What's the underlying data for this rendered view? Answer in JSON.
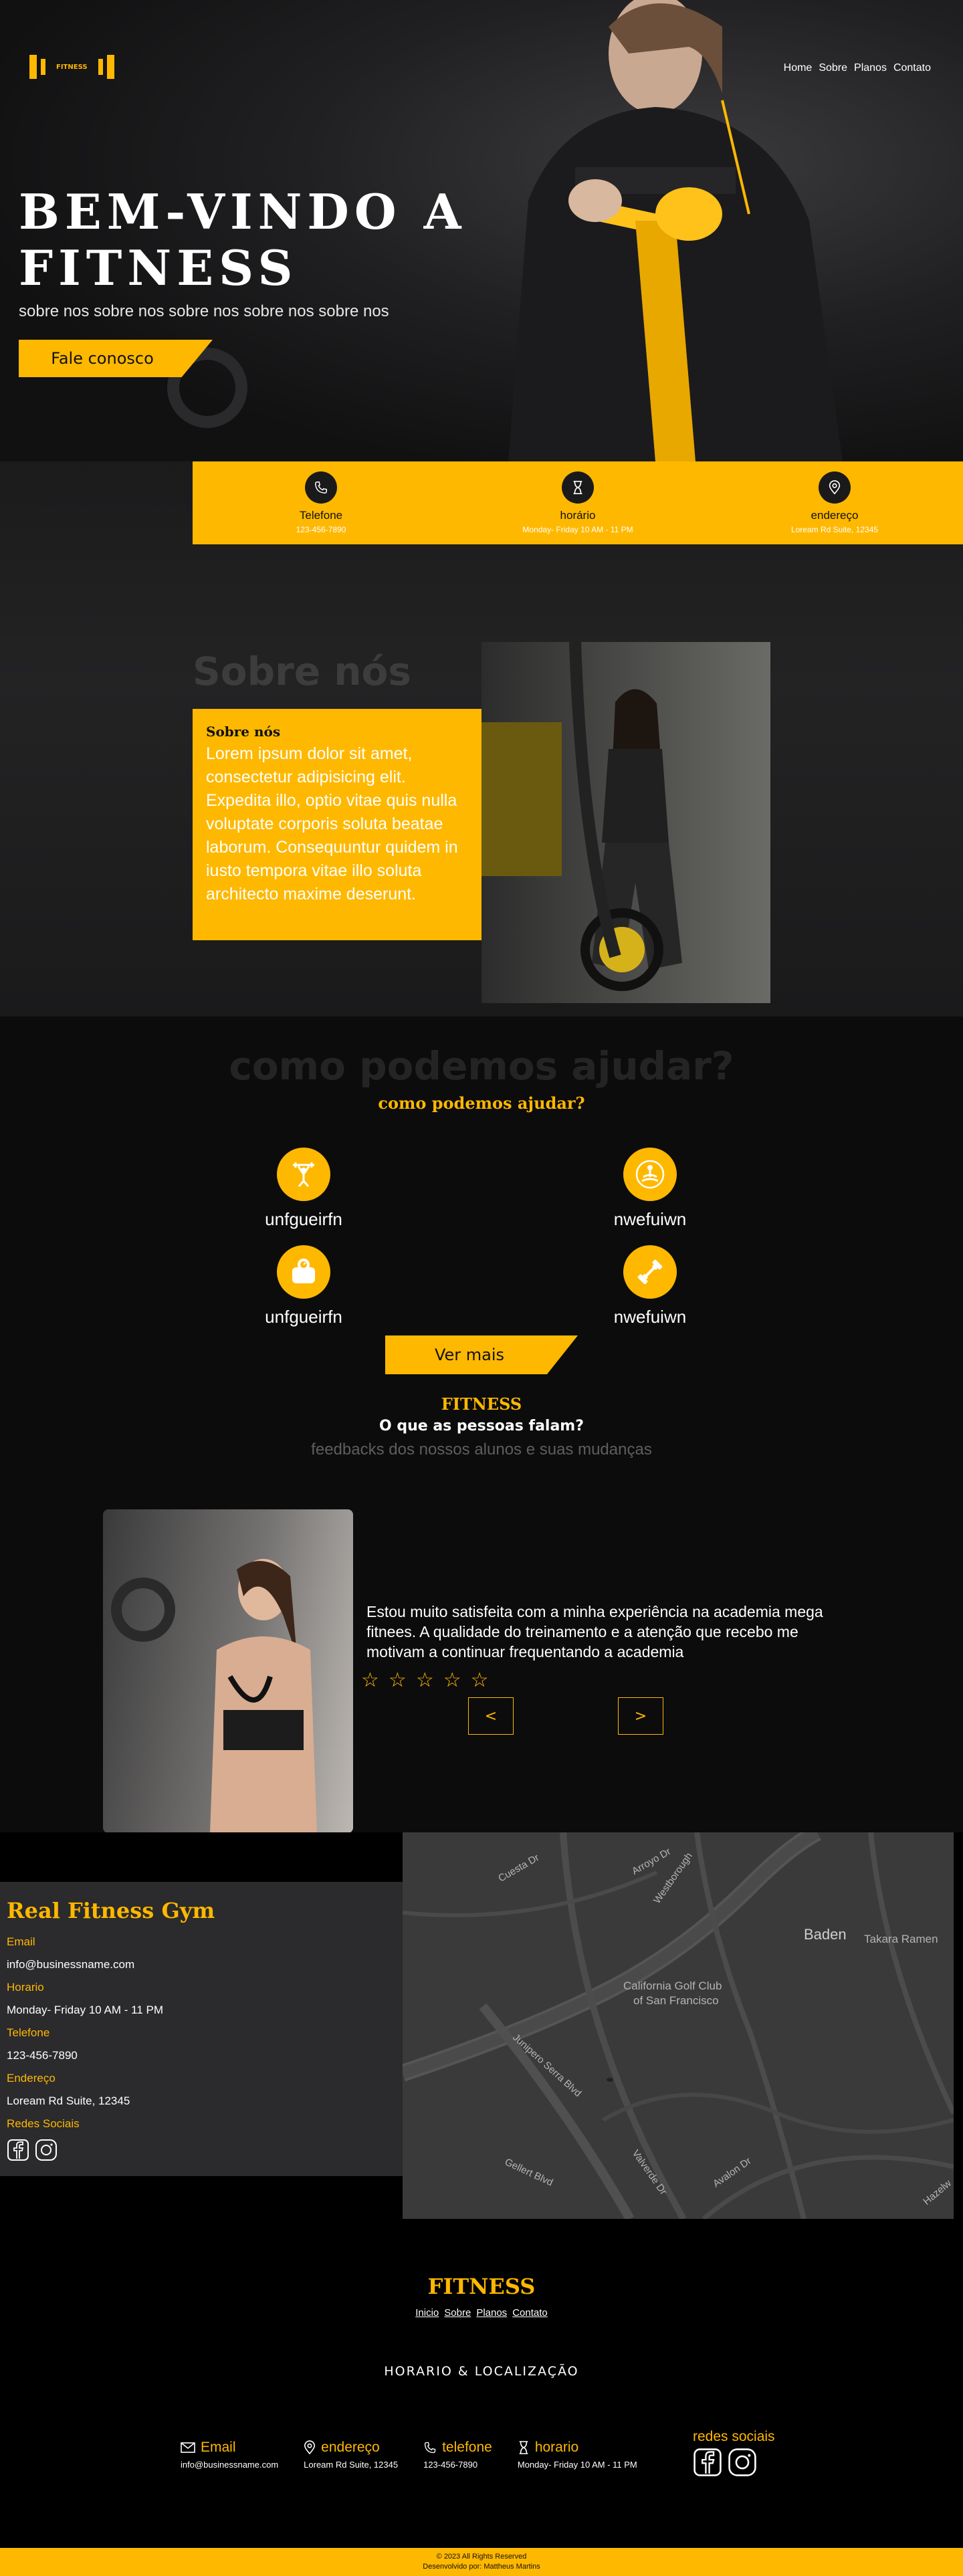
{
  "brand": {
    "logo_text": "FITNESS"
  },
  "nav": {
    "items": [
      "Home",
      "Sobre",
      "Planos",
      "Contato"
    ]
  },
  "hero": {
    "title_line1": "BEM-VINDO A",
    "title_line2": "FITNESS",
    "subtitle": "sobre nos sobre nos sobre nos sobre nos sobre nos",
    "cta": "Fale conosco"
  },
  "infobar": [
    {
      "icon": "phone-icon",
      "label": "Telefone",
      "value": "123-456-7890"
    },
    {
      "icon": "hourglass-icon",
      "label": "horário",
      "value": "Monday- Friday 10 AM - 11 PM"
    },
    {
      "icon": "location-icon",
      "label": "endereço",
      "value": "Loream Rd Suite, 12345"
    }
  ],
  "about": {
    "ghost_title": "Sobre nós",
    "card_title": "Sobre nós",
    "card_text": "Lorem ipsum dolor sit amet, consectetur adipisicing elit. Expedita illo, optio vitae quis nulla voluptate corporis soluta beatae laborum. Consequuntur quidem in iusto tempora vitae illo soluta architecto maxime deserunt."
  },
  "services": {
    "ghost_title": "como podemos ajudar?",
    "title": "como podemos ajudar?",
    "items": [
      {
        "icon": "weightlifter-icon",
        "label": "unfgueirfn"
      },
      {
        "icon": "meditation-icon",
        "label": "nwefuiwn"
      },
      {
        "icon": "scale-icon",
        "label": "unfgueirfn"
      },
      {
        "icon": "dumbbell-icon",
        "label": "nwefuiwn"
      }
    ],
    "cta": "Ver mais"
  },
  "feedback": {
    "brand": "FITNESS",
    "question": "O que as pessoas falam?",
    "subtitle": "feedbacks dos nossos alunos e suas mudanças",
    "quote": "Estou muito satisfeita com a minha experiência na academia mega fitnees. A qualidade do treinamento e a atenção que recebo me motivam a continuar frequentando a academia",
    "rating": 5,
    "prev": "<",
    "next": ">"
  },
  "contact": {
    "title": "Real Fitness Gym",
    "email_label": "Email",
    "email": "info@businessname.com",
    "hours_label": "Horario",
    "hours": "Monday- Friday 10 AM - 11 PM",
    "phone_label": "Telefone",
    "phone": "123-456-7890",
    "address_label": "Endereço",
    "address": "Loream Rd Suite, 12345",
    "social_label": "Redes Sociais"
  },
  "map": {
    "labels": [
      "Baden",
      "Takara Ramen",
      "California Golf Club",
      "of San Francisco",
      "Junipero Serra Blvd",
      "Westborough",
      "Gellert Blvd",
      "Valverde Dr",
      "Avalon Dr",
      "Cuesta Dr",
      "Arroyo Dr",
      "Hazelw"
    ]
  },
  "footer": {
    "brand": "FITNESS",
    "nav": [
      "Inicio",
      "Sobre",
      "Planos",
      "Contato"
    ],
    "heading": "HORARIO & LOCALIZAÇÃO",
    "cols": [
      {
        "icon": "mail-icon",
        "label": "Email",
        "value": "info@businessname.com"
      },
      {
        "icon": "location-icon",
        "label": "endereço",
        "value": "Loream Rd Suite, 12345"
      },
      {
        "icon": "phone-icon",
        "label": "telefone",
        "value": "123-456-7890"
      },
      {
        "icon": "hourglass-icon",
        "label": "horario",
        "value": "Monday- Friday 10 AM - 11 PM"
      }
    ],
    "social_label": "redes sociais",
    "copyright": "© 2023 All Rights Reserved",
    "dev": "Desenvolvido por: Mattheus Martins"
  },
  "colors": {
    "accent": "#ffb800",
    "dark": "#0b0b0c",
    "panel": "#2b2b2d"
  }
}
